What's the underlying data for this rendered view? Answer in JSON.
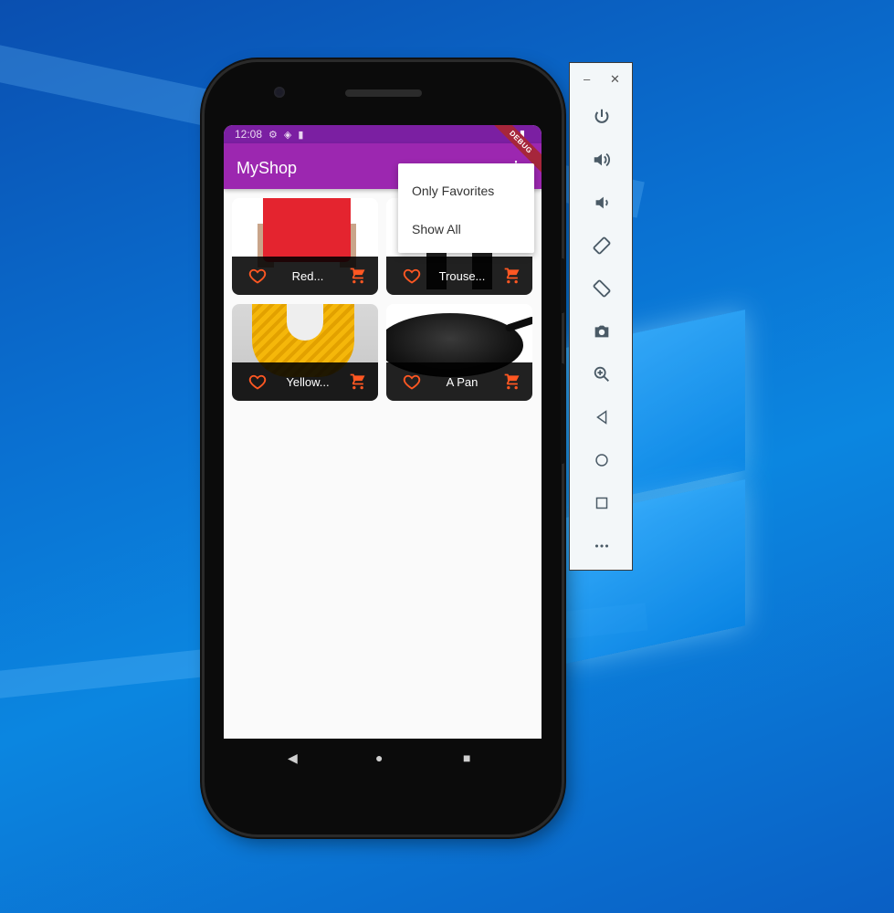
{
  "status_bar": {
    "time": "12:08"
  },
  "app": {
    "title": "MyShop",
    "debug_banner": "DEBUG"
  },
  "menu": {
    "items": [
      "Only Favorites",
      "Show All"
    ]
  },
  "products": [
    {
      "title": "Red..."
    },
    {
      "title": "Trouse..."
    },
    {
      "title": "Yellow..."
    },
    {
      "title": "A Pan"
    }
  ],
  "colors": {
    "appbar": "#9c27b0",
    "statusbar": "#7b1fa2",
    "accent": "#ff5722",
    "tile_footer": "#000000"
  },
  "icons": {
    "tile": [
      "heart-outline-icon",
      "cart-icon"
    ],
    "emulator_toolbar": [
      "minimize-icon",
      "close-icon",
      "power-icon",
      "volume-up-icon",
      "volume-down-icon",
      "rotate-left-icon",
      "rotate-right-icon",
      "camera-icon",
      "zoom-icon",
      "back-icon",
      "home-icon",
      "overview-icon",
      "more-icon"
    ]
  }
}
